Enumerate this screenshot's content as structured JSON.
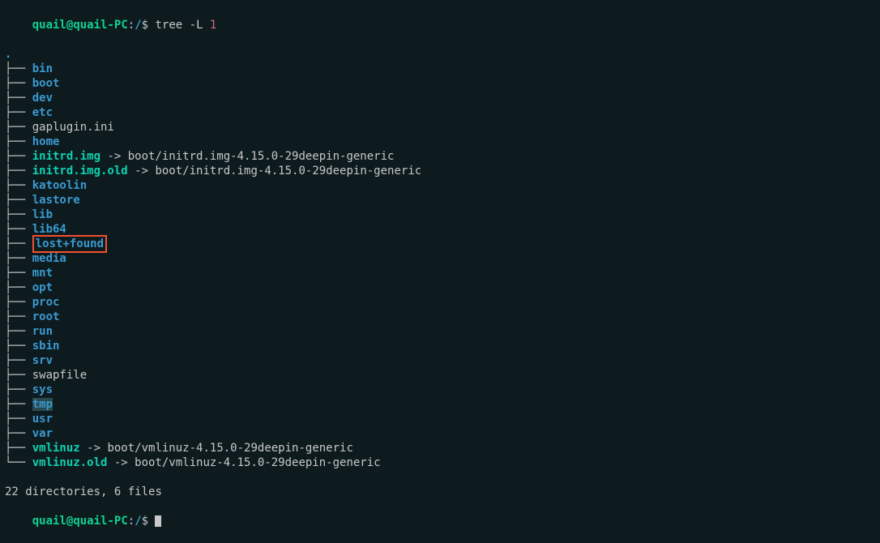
{
  "prompt": {
    "user": "quail",
    "at": "@",
    "host": "quail-PC",
    "colon": ":",
    "path": "/",
    "dollar": "$",
    "command": " tree -L ",
    "arg": "1"
  },
  "tree": {
    "root": ".",
    "branch_mid": "├── ",
    "branch_end": "└── ",
    "entries": [
      {
        "name": "bin",
        "type": "dir"
      },
      {
        "name": "boot",
        "type": "dir"
      },
      {
        "name": "dev",
        "type": "dir"
      },
      {
        "name": "etc",
        "type": "dir"
      },
      {
        "name": "gaplugin.ini",
        "type": "file"
      },
      {
        "name": "home",
        "type": "dir"
      },
      {
        "name": "initrd.img",
        "type": "sym",
        "arrow": " -> ",
        "target": "boot/initrd.img-4.15.0-29deepin-generic"
      },
      {
        "name": "initrd.img.old",
        "type": "sym",
        "arrow": " -> ",
        "target": "boot/initrd.img-4.15.0-29deepin-generic"
      },
      {
        "name": "katoolin",
        "type": "dir"
      },
      {
        "name": "lastore",
        "type": "dir"
      },
      {
        "name": "lib",
        "type": "dir"
      },
      {
        "name": "lib64",
        "type": "dir"
      },
      {
        "name": "lost+found",
        "type": "dir",
        "highlighted": true
      },
      {
        "name": "media",
        "type": "dir"
      },
      {
        "name": "mnt",
        "type": "dir"
      },
      {
        "name": "opt",
        "type": "dir"
      },
      {
        "name": "proc",
        "type": "dir"
      },
      {
        "name": "root",
        "type": "dir"
      },
      {
        "name": "run",
        "type": "dir"
      },
      {
        "name": "sbin",
        "type": "dir"
      },
      {
        "name": "srv",
        "type": "dir"
      },
      {
        "name": "swapfile",
        "type": "file"
      },
      {
        "name": "sys",
        "type": "dir"
      },
      {
        "name": "tmp",
        "type": "sticky"
      },
      {
        "name": "usr",
        "type": "dir"
      },
      {
        "name": "var",
        "type": "dir"
      },
      {
        "name": "vmlinuz",
        "type": "sym",
        "arrow": " -> ",
        "target": "boot/vmlinuz-4.15.0-29deepin-generic"
      },
      {
        "name": "vmlinuz.old",
        "type": "sym",
        "arrow": " -> ",
        "target": "boot/vmlinuz-4.15.0-29deepin-generic",
        "last": true
      }
    ]
  },
  "summary": {
    "text_a": "22",
    "label_a": " directories, ",
    "text_b": "6",
    "label_b": " files"
  },
  "prompt2": {
    "user": "quail",
    "at": "@",
    "host": "quail-PC",
    "colon": ":",
    "path": "/",
    "dollar": "$ "
  }
}
